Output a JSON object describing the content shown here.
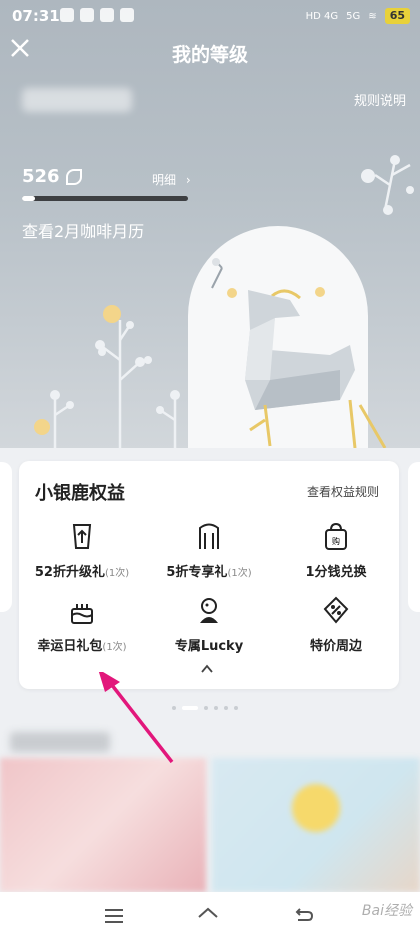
{
  "status_bar": {
    "time": "07:31",
    "network_1": "HD 4G",
    "network_2": "5G",
    "battery": "65"
  },
  "header": {
    "title": "我的等级",
    "rules_link": "规则说明"
  },
  "level": {
    "points": "526",
    "detail_link": "明细",
    "progress_fraction": 0.08,
    "calendar_text": "查看2月咖啡月历"
  },
  "benefits": {
    "title": "小银鹿权益",
    "rules_link": "查看权益规则",
    "items": [
      {
        "label": "52折升级礼",
        "count": "(1次)",
        "icon": "cup-upgrade-icon"
      },
      {
        "label": "5折专享礼",
        "count": "(1次)",
        "icon": "door-gift-icon"
      },
      {
        "label": "1分钱兑换",
        "count": "",
        "icon": "shopping-bag-icon"
      },
      {
        "label": "幸运日礼包",
        "count": "(1次)",
        "icon": "birthday-cake-icon"
      },
      {
        "label": "专属Lucky",
        "count": "",
        "icon": "mascot-icon"
      },
      {
        "label": "特价周边",
        "count": "",
        "icon": "coupon-ticket-icon"
      }
    ]
  },
  "carousel": {
    "pages": 6,
    "active_index": 1
  },
  "nav_bar": {
    "items": [
      "menu-icon",
      "home-icon",
      "back-icon"
    ]
  },
  "watermark": "Bai经验",
  "colors": {
    "accent_arrow": "#e2177b",
    "hero_bg": "#b4bcc4",
    "progress_track": "#3d3f42"
  }
}
